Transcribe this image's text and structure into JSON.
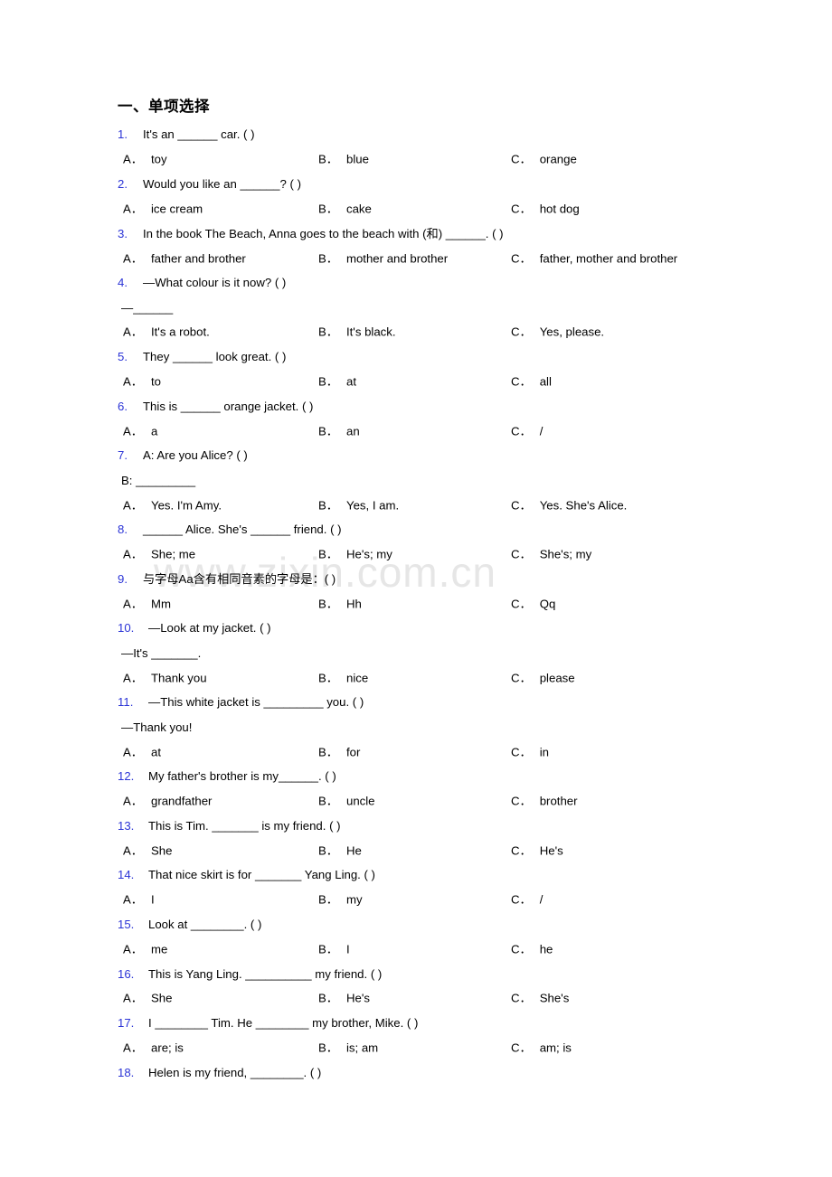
{
  "watermark": {
    "text": "www.zixin.com.cn"
  },
  "heading": {
    "title": "一、单项选择"
  },
  "questions": [
    {
      "num": "1.",
      "stem": "It's an ______ car. (   )",
      "options": {
        "a_label": "A．",
        "a_text": "toy",
        "b_label": "B．",
        "b_text": "blue",
        "c_label": "C．",
        "c_text": "orange"
      }
    },
    {
      "num": "2.",
      "stem": "Would you like an ______? (   )",
      "options": {
        "a_label": "A．",
        "a_text": "ice cream",
        "b_label": "B．",
        "b_text": "cake",
        "c_label": "C．",
        "c_text": "hot dog"
      }
    },
    {
      "num": "3.",
      "stem": "In the book The Beach, Anna goes to the beach with (和) ______. (   )",
      "options": {
        "a_label": "A．",
        "a_text": "father and brother",
        "b_label": "B．",
        "b_text": "mother and brother",
        "c_label": "C．",
        "c_text": "father, mother and brother"
      }
    },
    {
      "num": "4.",
      "stem": "—What colour is it now? (   )",
      "continuation": "—______",
      "options": {
        "a_label": "A．",
        "a_text": "It's a robot.",
        "b_label": "B．",
        "b_text": "It's black.",
        "c_label": "C．",
        "c_text": "Yes, please."
      }
    },
    {
      "num": "5.",
      "stem": "They ______ look great. (   )",
      "options": {
        "a_label": "A．",
        "a_text": "to",
        "b_label": "B．",
        "b_text": "at",
        "c_label": "C．",
        "c_text": "all"
      }
    },
    {
      "num": "6.",
      "stem": "This is ______ orange jacket. (   )",
      "options": {
        "a_label": "A．",
        "a_text": "a",
        "b_label": "B．",
        "b_text": "an",
        "c_label": "C．",
        "c_text": "/"
      }
    },
    {
      "num": "7.",
      "stem": "A: Are you Alice?  (    )",
      "continuation": "B: _________",
      "options": {
        "a_label": "A．",
        "a_text": "Yes. I'm Amy.",
        "b_label": "B．",
        "b_text": "Yes, I am.",
        "c_label": "C．",
        "c_text": "Yes. She's Alice."
      }
    },
    {
      "num": "8.",
      "stem": "______ Alice. She's ______ friend. (   )",
      "options": {
        "a_label": "A．",
        "a_text": "She; me",
        "b_label": "B．",
        "b_text": "He's; my",
        "c_label": "C．",
        "c_text": "She's; my"
      }
    },
    {
      "num": "9.",
      "stem": "与字母Aa含有相同音素的字母是：(   )",
      "options": {
        "a_label": "A．",
        "a_text": "Mm",
        "b_label": "B．",
        "b_text": "Hh",
        "c_label": "C．",
        "c_text": "Qq"
      }
    },
    {
      "num": "10.",
      "stem": "—Look at my jacket. (   )",
      "continuation": "—It's _______.",
      "options": {
        "a_label": "A．",
        "a_text": "Thank you",
        "b_label": "B．",
        "b_text": "nice",
        "c_label": "C．",
        "c_text": "please"
      }
    },
    {
      "num": "11.",
      "stem": "—This white jacket is _________ you. ( )",
      "continuation": "—Thank you!",
      "options": {
        "a_label": "A．",
        "a_text": "at",
        "b_label": "B．",
        "b_text": "for",
        "c_label": "C．",
        "c_text": "in"
      }
    },
    {
      "num": "12.",
      "stem": "My father's brother is my______. (   )",
      "options": {
        "a_label": "A．",
        "a_text": "grandfather",
        "b_label": "B．",
        "b_text": "uncle",
        "c_label": "C．",
        "c_text": "brother"
      }
    },
    {
      "num": "13.",
      "stem": "This is Tim. _______ is my friend. (   )",
      "options": {
        "a_label": "A．",
        "a_text": "She",
        "b_label": "B．",
        "b_text": "He",
        "c_label": "C．",
        "c_text": "He's"
      }
    },
    {
      "num": "14.",
      "stem": "That nice skirt is for _______ Yang Ling. (   )",
      "options": {
        "a_label": "A．",
        "a_text": "I",
        "b_label": "B．",
        "b_text": "my",
        "c_label": "C．",
        "c_text": "/"
      }
    },
    {
      "num": "15.",
      "stem": "Look at ________. (     )",
      "options": {
        "a_label": "A．",
        "a_text": "me",
        "b_label": "B．",
        "b_text": "I",
        "c_label": "C．",
        "c_text": "he"
      }
    },
    {
      "num": "16.",
      "stem": "This is Yang Ling. __________ my friend. (   )",
      "options": {
        "a_label": "A．",
        "a_text": "She",
        "b_label": "B．",
        "b_text": "He's",
        "c_label": "C．",
        "c_text": "She's"
      }
    },
    {
      "num": "17.",
      "stem": "I ________ Tim. He ________ my brother, Mike. (   )",
      "options": {
        "a_label": "A．",
        "a_text": "are; is",
        "b_label": "B．",
        "b_text": "is; am",
        "c_label": "C．",
        "c_text": "am; is"
      }
    },
    {
      "num": "18.",
      "stem": "Helen is my friend, ________. (   )"
    }
  ]
}
